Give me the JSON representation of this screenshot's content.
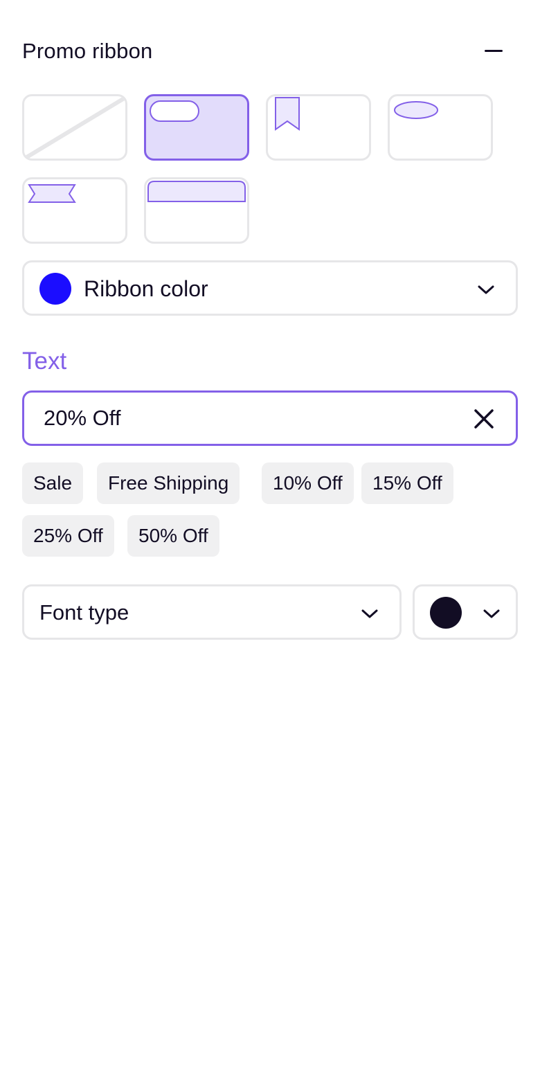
{
  "header": {
    "title": "Promo ribbon",
    "collapse_icon": "minus-icon"
  },
  "ribbon_styles": {
    "selected": "pill",
    "options": [
      "none",
      "pill",
      "bookmark",
      "oval",
      "banner",
      "top-bar"
    ]
  },
  "ribbon_color": {
    "label": "Ribbon color",
    "swatch": "#1b0dff",
    "icon": "chevron-down-icon"
  },
  "text_section": {
    "heading": "Text",
    "value": "20% Off",
    "clear_icon": "close-icon",
    "suggestions": [
      "Sale",
      "Free Shipping",
      "10% Off",
      "15% Off",
      "25% Off",
      "50% Off"
    ]
  },
  "font": {
    "label": "Font type",
    "icon": "chevron-down-icon"
  },
  "text_color": {
    "swatch": "#120d24",
    "icon": "chevron-down-icon"
  },
  "colors": {
    "accent": "#8360e8",
    "accent_fill": "#e2dcfb",
    "border": "#e6e6e8",
    "chip_bg": "#f0f0f1",
    "text": "#120d24"
  }
}
